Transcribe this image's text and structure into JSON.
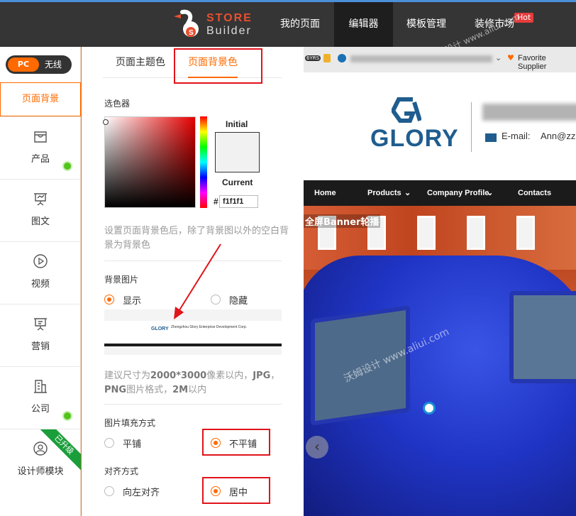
{
  "topbar": {
    "logo_line1": "STORE",
    "logo_line2": "Builder",
    "nav": [
      "我的页面",
      "编辑器",
      "模板管理",
      "装修市场"
    ],
    "hot_badge": "Hot",
    "watermark": "沃姆设计 www.aliui.com"
  },
  "sidebar": {
    "toggle_pc": "PC",
    "toggle_none": "无线",
    "items": [
      {
        "label": "页面背景",
        "icon": "page-background"
      },
      {
        "label": "产品",
        "icon": "bag-icon"
      },
      {
        "label": "图文",
        "icon": "presentation-icon"
      },
      {
        "label": "视频",
        "icon": "play-icon"
      },
      {
        "label": "营销",
        "icon": "marketing-icon"
      },
      {
        "label": "公司",
        "icon": "building-icon"
      },
      {
        "label": "设计师模块",
        "icon": "user-icon"
      }
    ],
    "ribbon": "已升级"
  },
  "panel": {
    "tab_theme": "页面主题色",
    "tab_bg": "页面背景色",
    "picker_title": "选色器",
    "initial_label": "Initial",
    "current_label": "Current",
    "hash": "#",
    "hex_value": "f1f1f1",
    "current_color": "#f1f1f1",
    "bg_hint": "设置页面背景色后，除了背景图以外的空白背景为背景色",
    "bg_image_title": "背景图片",
    "show": "显示",
    "hide": "隐藏",
    "size_hint_pre": "建议尺寸为",
    "size_hint_size": "2000*3000",
    "size_hint_mid": "像素以内，",
    "size_hint_jpg": "JPG",
    "size_hint_comma": "，",
    "size_hint_png": "PNG",
    "size_hint_fmt": "图片格式，",
    "size_hint_2m": "2M",
    "size_hint_end": "以内",
    "fill_title": "图片填充方式",
    "fill_tile": "平铺",
    "fill_notile": "不平铺",
    "align_title": "对齐方式",
    "align_left": "向左对齐",
    "align_center": "居中",
    "thumb_company": "Zhengzhou Glory Enterprise Development Corp."
  },
  "preview": {
    "years": "6YRS",
    "favorite": "Favorite Supplier",
    "brand": "GLORY",
    "email_label": "E-mail:",
    "email_value": "Ann@zz",
    "nav": [
      "Home",
      "Products",
      "Company Profile",
      "Contacts"
    ],
    "banner_label": "全屏Banner轮播",
    "accent": "#ff6a00"
  }
}
